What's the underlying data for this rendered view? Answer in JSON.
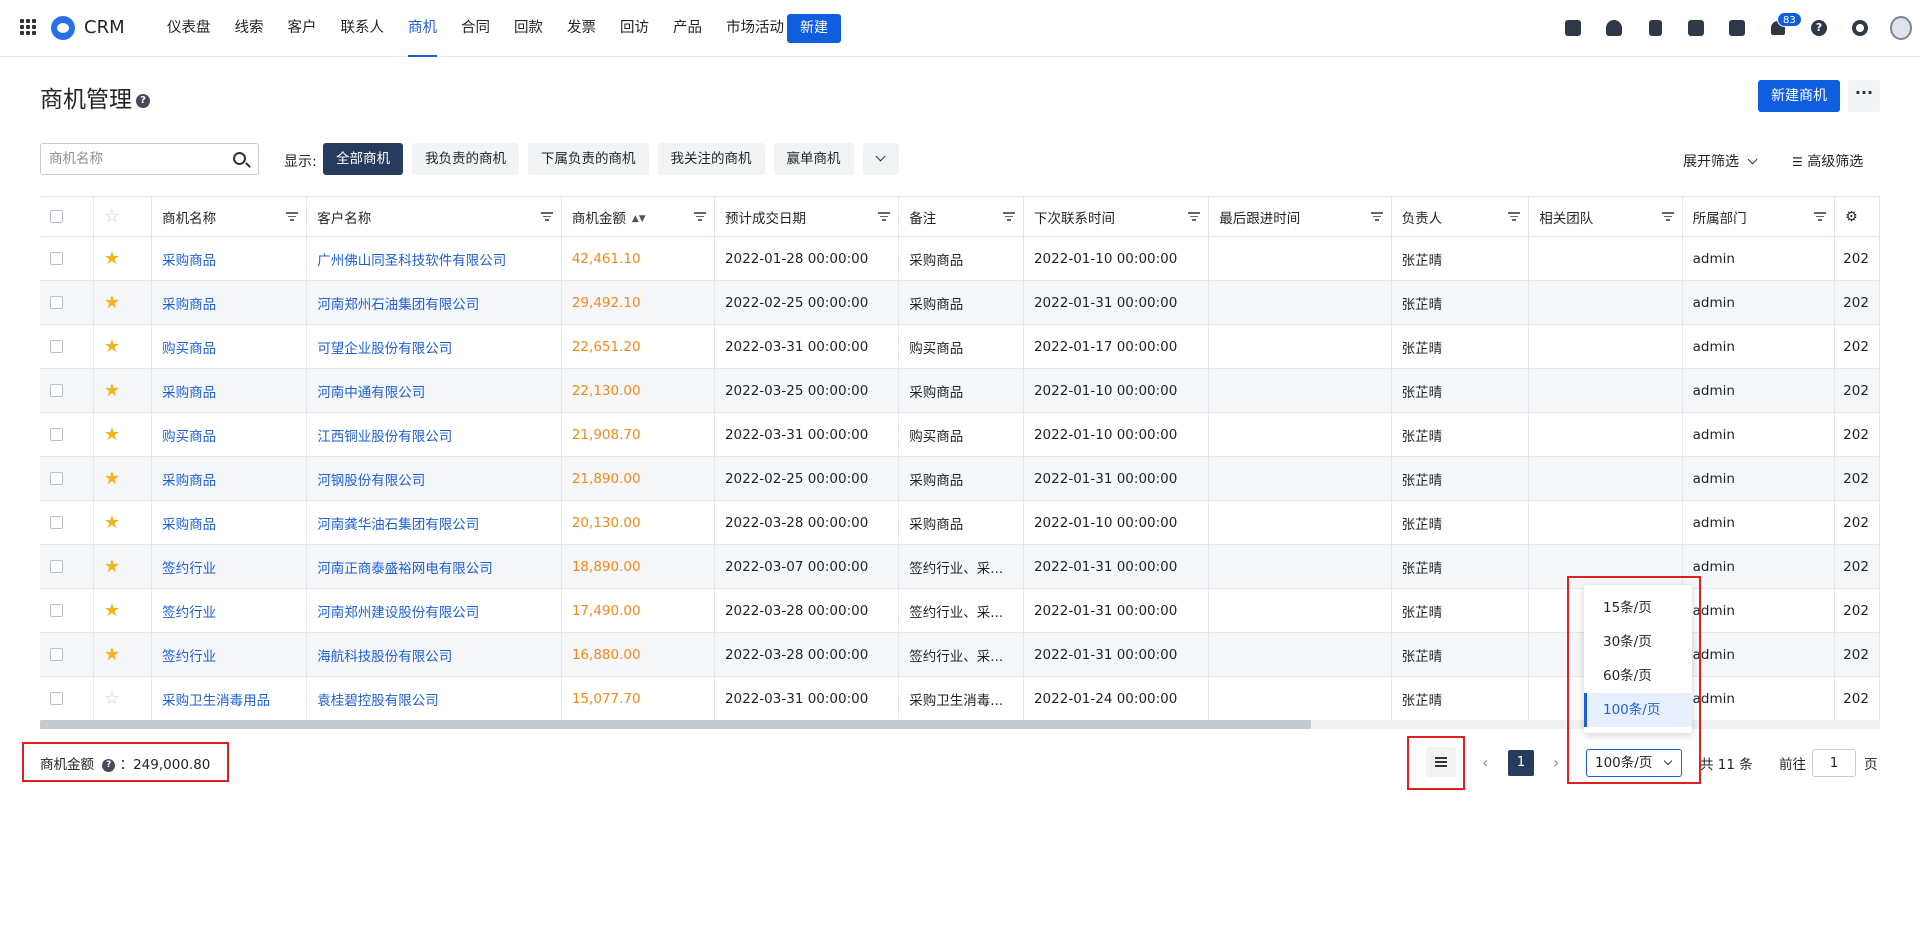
{
  "app": {
    "brand": "CRM"
  },
  "nav": {
    "items": [
      "仪表盘",
      "线索",
      "客户",
      "联系人",
      "商机",
      "合同",
      "回款",
      "发票",
      "回访",
      "产品",
      "市场活动"
    ],
    "active_index": 4,
    "new_label": "新建"
  },
  "top_icons": {
    "notification_count": "83",
    "help_glyph": "?"
  },
  "header": {
    "title": "商机管理",
    "help_glyph": "?",
    "new_button": "新建商机",
    "more_glyph": "···"
  },
  "toolbar": {
    "search_placeholder": "商机名称",
    "show_label": "显示:",
    "filters": [
      "全部商机",
      "我负责的商机",
      "下属负责的商机",
      "我关注的商机",
      "赢单商机"
    ],
    "active_filter_index": 0,
    "expand_filter": "展开筛选",
    "advanced_filter": "高级筛选"
  },
  "table": {
    "columns": [
      "商机名称",
      "客户名称",
      "商机金额",
      "预计成交日期",
      "备注",
      "下次联系时间",
      "最后跟进时间",
      "负责人",
      "相关团队",
      "所属部门"
    ],
    "rows": [
      {
        "starred": true,
        "name": "采购商品",
        "customer": "广州佛山同圣科技软件有限公司",
        "amount": "42,461.10",
        "deal_date": "2022-01-28 00:00:00",
        "note": "采购商品",
        "next_contact": "2022-01-10 00:00:00",
        "last_follow": "",
        "owner": "张芷晴",
        "team": "",
        "dept": "admin",
        "extra": "202"
      },
      {
        "starred": true,
        "name": "采购商品",
        "customer": "河南郑州石油集团有限公司",
        "amount": "29,492.10",
        "deal_date": "2022-02-25 00:00:00",
        "note": "采购商品",
        "next_contact": "2022-01-31 00:00:00",
        "last_follow": "",
        "owner": "张芷晴",
        "team": "",
        "dept": "admin",
        "extra": "202"
      },
      {
        "starred": true,
        "name": "购买商品",
        "customer": "可望企业股份有限公司",
        "amount": "22,651.20",
        "deal_date": "2022-03-31 00:00:00",
        "note": "购买商品",
        "next_contact": "2022-01-17 00:00:00",
        "last_follow": "",
        "owner": "张芷晴",
        "team": "",
        "dept": "admin",
        "extra": "202"
      },
      {
        "starred": true,
        "name": "采购商品",
        "customer": "河南中通有限公司",
        "amount": "22,130.00",
        "deal_date": "2022-03-25 00:00:00",
        "note": "采购商品",
        "next_contact": "2022-01-10 00:00:00",
        "last_follow": "",
        "owner": "张芷晴",
        "team": "",
        "dept": "admin",
        "extra": "202"
      },
      {
        "starred": true,
        "name": "购买商品",
        "customer": "江西铜业股份有限公司",
        "amount": "21,908.70",
        "deal_date": "2022-03-31 00:00:00",
        "note": "购买商品",
        "next_contact": "2022-01-10 00:00:00",
        "last_follow": "",
        "owner": "张芷晴",
        "team": "",
        "dept": "admin",
        "extra": "202"
      },
      {
        "starred": true,
        "name": "采购商品",
        "customer": "河钢股份有限公司",
        "amount": "21,890.00",
        "deal_date": "2022-02-25 00:00:00",
        "note": "采购商品",
        "next_contact": "2022-01-31 00:00:00",
        "last_follow": "",
        "owner": "张芷晴",
        "team": "",
        "dept": "admin",
        "extra": "202"
      },
      {
        "starred": true,
        "name": "采购商品",
        "customer": "河南龚华油石集团有限公司",
        "amount": "20,130.00",
        "deal_date": "2022-03-28 00:00:00",
        "note": "采购商品",
        "next_contact": "2022-01-10 00:00:00",
        "last_follow": "",
        "owner": "张芷晴",
        "team": "",
        "dept": "admin",
        "extra": "202"
      },
      {
        "starred": true,
        "name": "签约行业",
        "customer": "河南正商泰盛裕网电有限公司",
        "amount": "18,890.00",
        "deal_date": "2022-03-07 00:00:00",
        "note": "签约行业、采...",
        "next_contact": "2022-01-31 00:00:00",
        "last_follow": "",
        "owner": "张芷晴",
        "team": "",
        "dept": "admin",
        "extra": "202"
      },
      {
        "starred": true,
        "name": "签约行业",
        "customer": "河南郑州建设股份有限公司",
        "amount": "17,490.00",
        "deal_date": "2022-03-28 00:00:00",
        "note": "签约行业、采...",
        "next_contact": "2022-01-31 00:00:00",
        "last_follow": "",
        "owner": "张芷晴",
        "team": "",
        "dept": "admin",
        "extra": "202"
      },
      {
        "starred": true,
        "name": "签约行业",
        "customer": "海航科技股份有限公司",
        "amount": "16,880.00",
        "deal_date": "2022-03-28 00:00:00",
        "note": "签约行业、采...",
        "next_contact": "2022-01-31 00:00:00",
        "last_follow": "",
        "owner": "张芷晴",
        "team": "",
        "dept": "admin",
        "extra": "202"
      },
      {
        "starred": false,
        "name": "采购卫生消毒用品",
        "customer": "袁桂碧控股有限公司",
        "amount": "15,077.70",
        "deal_date": "2022-03-31 00:00:00",
        "note": "采购卫生消毒...",
        "next_contact": "2022-01-24 00:00:00",
        "last_follow": "",
        "owner": "张芷晴",
        "team": "",
        "dept": "admin",
        "extra": "202"
      }
    ]
  },
  "footer": {
    "summary_label": "商机金额",
    "summary_value": "：249,000.80",
    "current_page": "1",
    "page_size": "100条/页",
    "total": "共 11 条",
    "goto_label": "前往",
    "goto_value": "1",
    "page_unit": "页"
  },
  "page_size_options": [
    "15条/页",
    "30条/页",
    "60条/页",
    "100条/页"
  ],
  "page_size_selected_index": 3,
  "colors": {
    "accent": "#0f5ee0",
    "active_chip": "#263b5e",
    "amount": "#f28a1b",
    "highlight_box": "#e02020"
  }
}
